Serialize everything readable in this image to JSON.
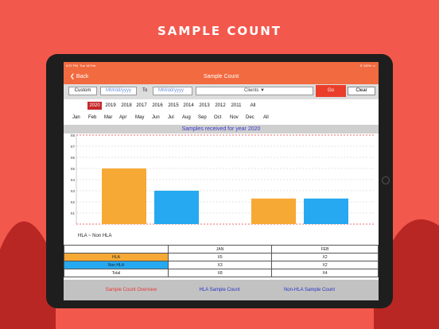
{
  "promo_title": "SAMPLE COUNT",
  "status_bar": {
    "time": "8:57 PM",
    "date": "Tue 18 Feb",
    "battery": "100%"
  },
  "navbar": {
    "back_label": "Back",
    "title": "Sample Count"
  },
  "filter": {
    "custom_label": "Custom",
    "from_placeholder": "MM/dd/yyyy",
    "to_label": "To",
    "to_placeholder": "MM/dd/yyyy",
    "clients_value": "Clients",
    "go_label": "Go",
    "clear_label": "Clear"
  },
  "years": [
    "2020",
    "2019",
    "2018",
    "2017",
    "2016",
    "2015",
    "2014",
    "2013",
    "2012",
    "2011",
    "All"
  ],
  "selected_year": "2020",
  "months": [
    "Jan",
    "Feb",
    "Mar",
    "Apr",
    "May",
    "Jun",
    "Jul",
    "Aug",
    "Sep",
    "Oct",
    "Nov",
    "Dec",
    "All"
  ],
  "chart_title": "Samples received for year 2020",
  "chart_data": {
    "type": "bar",
    "categories": [
      "JAN",
      "FEB"
    ],
    "y_ticks": [
      "X1",
      "X2",
      "X3",
      "X4",
      "X5",
      "X6",
      "X7",
      "X8"
    ],
    "ylim": [
      0,
      8
    ],
    "grid": true,
    "series": [
      {
        "name": "HLA",
        "values": [
          5,
          2.3
        ],
        "color": "#f7a935"
      },
      {
        "name": "Non HLA",
        "values": [
          3,
          2.3
        ],
        "color": "#26a9f0"
      }
    ],
    "legend_text": "HLA ~ Non HLA"
  },
  "table": {
    "headers": [
      "",
      "JAN",
      "FEB"
    ],
    "rows": [
      {
        "label": "HLA",
        "values": [
          "X5",
          "X2"
        ]
      },
      {
        "label": "Non HLA",
        "values": [
          "X3",
          "X2"
        ]
      },
      {
        "label": "Total",
        "values": [
          "X8",
          "X4"
        ]
      }
    ]
  },
  "tabs": [
    "Sample Count Overview",
    "HLA Sample Count",
    "Non-HLA Sample Count"
  ],
  "colors": {
    "background": "#f3584c",
    "header": "#f26a3f",
    "hla": "#f7a935",
    "non_hla": "#26a9f0",
    "go": "#ea3e2b"
  }
}
